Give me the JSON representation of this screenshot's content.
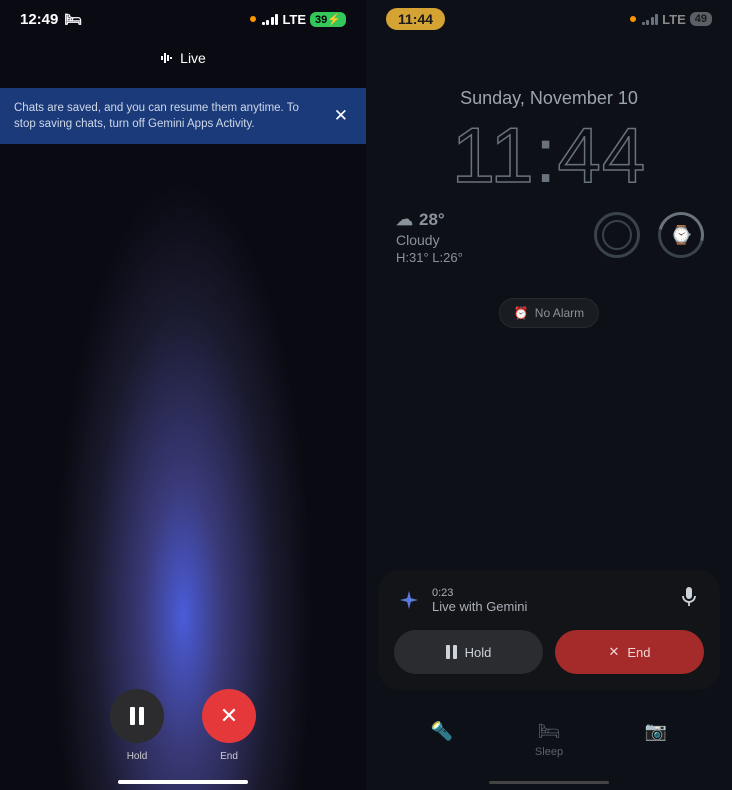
{
  "left_screen": {
    "status": {
      "time": "12:49",
      "network": "LTE",
      "battery": "39"
    },
    "header_label": "Live",
    "banner": {
      "text": "Chats are saved, and you can resume them anytime. To stop saving chats, turn off Gemini Apps Activity."
    },
    "controls": {
      "hold_label": "Hold",
      "end_label": "End"
    }
  },
  "right_screen": {
    "status": {
      "time_pill": "11:44",
      "network": "LTE",
      "battery": "49"
    },
    "lock": {
      "date": "Sunday, November 10",
      "time_h": "11",
      "time_m": "44"
    },
    "weather": {
      "temp": "28°",
      "condition": "Cloudy",
      "high_low": "H:31° L:26°"
    },
    "alarm": {
      "label": "No Alarm"
    },
    "gemini": {
      "duration": "0:23",
      "title": "Live with Gemini",
      "hold_label": "Hold",
      "end_label": "End"
    },
    "dock": {
      "sleep_label": "Sleep"
    }
  }
}
